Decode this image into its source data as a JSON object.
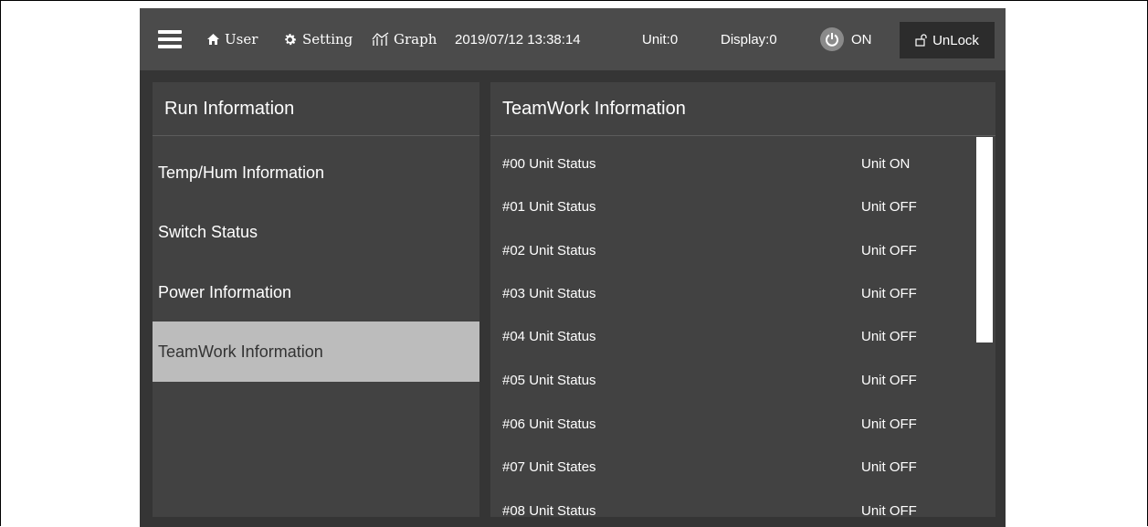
{
  "topbar": {
    "menu_icon": "hamburger-menu-icon",
    "user_label": "User",
    "user_icon": "home-icon",
    "setting_label": "Setting",
    "setting_icon": "gear-icon",
    "graph_label": "Graph",
    "graph_icon": "graph-icon",
    "datetime": "2019/07/12 13:38:14",
    "unit": "Unit:0",
    "display": "Display:0",
    "power_icon": "power-icon",
    "power_label": "ON",
    "lock_icon": "unlock-icon",
    "unlock_label": "UnLock"
  },
  "left_panel": {
    "title": "Run Information",
    "items": [
      {
        "label": "Temp/Hum Information"
      },
      {
        "label": "Switch Status"
      },
      {
        "label": "Power Information"
      },
      {
        "label": "TeamWork Information"
      }
    ],
    "active_index": 3
  },
  "right_panel": {
    "title": "TeamWork Information",
    "rows": [
      {
        "label": "#00 Unit Status",
        "value": "Unit ON"
      },
      {
        "label": "#01 Unit Status",
        "value": "Unit OFF"
      },
      {
        "label": "#02 Unit Status",
        "value": "Unit OFF"
      },
      {
        "label": "#03 Unit Status",
        "value": "Unit OFF"
      },
      {
        "label": "#04 Unit Status",
        "value": "Unit OFF"
      },
      {
        "label": "#05 Unit Status",
        "value": "Unit OFF"
      },
      {
        "label": "#06 Unit Status",
        "value": "Unit OFF"
      },
      {
        "label": "#07 Unit States",
        "value": "Unit OFF"
      },
      {
        "label": "#08 Unit Status",
        "value": "Unit OFF"
      }
    ]
  },
  "colors": {
    "screen_bg": "#353535",
    "topbar_bg": "#4b4b4b",
    "panel_bg": "#424242",
    "active_item_bg": "#bcbcbc",
    "unlock_bg": "#2c2c2c"
  }
}
